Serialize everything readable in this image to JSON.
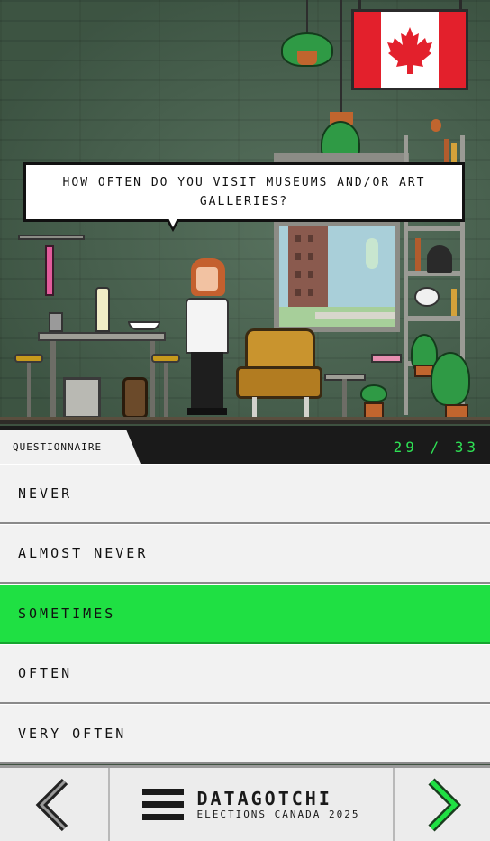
{
  "question": {
    "text": "How often do you visit museums and/or art galleries?"
  },
  "header": {
    "section_label": "QUESTIONNAIRE",
    "progress": "29 / 33",
    "progress_current": 29,
    "progress_total": 33
  },
  "options": [
    {
      "label": "NEVER",
      "selected": false
    },
    {
      "label": "ALMOST NEVER",
      "selected": false
    },
    {
      "label": "SOMETIMES",
      "selected": true
    },
    {
      "label": "OFTEN",
      "selected": false
    },
    {
      "label": "VERY OFTEN",
      "selected": false
    }
  ],
  "nav": {
    "prev_icon": "chevron-left-icon",
    "next_icon": "chevron-right-icon",
    "menu_icon": "hamburger-menu-icon",
    "brand_title": "DATAGOTCHI",
    "brand_subtitle": "ELECTIONS CANADA 2025"
  },
  "colors": {
    "accent_green": "#1fe043",
    "progress_green": "#2ee254",
    "flag_red": "#e3202c"
  }
}
